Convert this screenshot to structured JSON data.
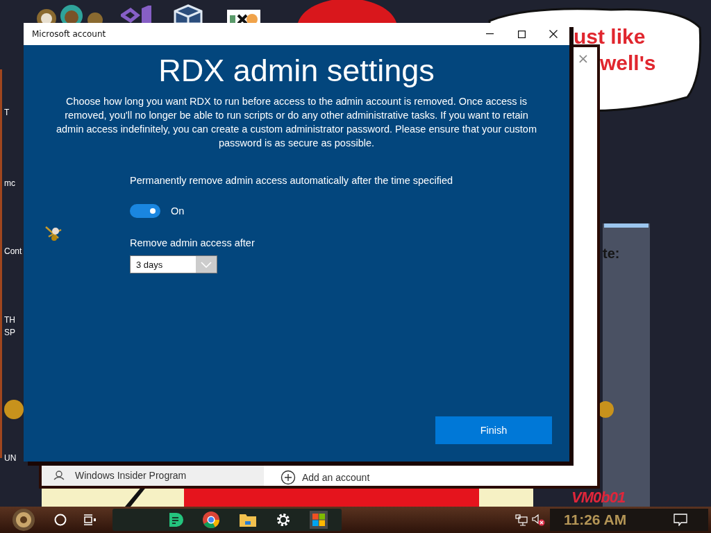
{
  "desktop": {
    "icon_labels": [
      "T",
      "mc",
      "Cont",
      "TH",
      "SP",
      "UN"
    ],
    "speech_bubble": [
      "ust like",
      "well's"
    ],
    "wallpaper_text": "VM0b01"
  },
  "side_window": {
    "text": "te:"
  },
  "background_window": {
    "close": "×",
    "insider": "Windows Insider Program",
    "add_account": "Add an account"
  },
  "dialog": {
    "window": {
      "title": "Microsoft account"
    },
    "heading": "RDX admin settings",
    "description": "Choose how long you want RDX to run before access to the admin account is removed. Once access is removed, you'll no longer be able to run scripts or do any other administrative tasks. If you want to retain admin access indefinitely, you can create a custom administrator password. Please ensure that your custom password is as secure as possible.",
    "auto_remove": {
      "label": "Permanently remove admin access automatically after the time specified",
      "on": true,
      "state_label": "On"
    },
    "remove_after": {
      "label": "Remove admin access after",
      "value": "3 days"
    },
    "finish": "Finish"
  },
  "taskbar": {
    "clock": "11:26 AM",
    "muted": true
  }
}
